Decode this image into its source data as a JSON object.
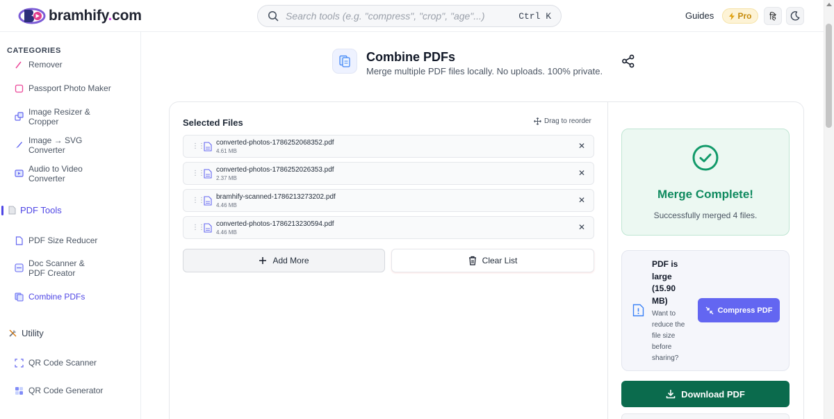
{
  "header": {
    "logo_text": "bramhify",
    "logo_dot": ".",
    "logo_tld": "com",
    "search_placeholder": "Search tools (e.g. \"compress\", \"crop\", \"age\"...)",
    "search_shortcut": "Ctrl K",
    "guides_label": "Guides",
    "pro_label": "Pro",
    "lang_label": "हि"
  },
  "sidebar": {
    "categories_title": "CATEGORIES",
    "image_items": [
      {
        "label": "Remover",
        "icon": "pencil-icon",
        "color": "#ec4899"
      },
      {
        "label": "Passport Photo Maker",
        "icon": "passport-icon",
        "color": "#ec4899"
      },
      {
        "label": "Image Resizer & Cropper",
        "icon": "resize-icon",
        "color": "#6366f1"
      },
      {
        "label": "Image → SVG Converter",
        "icon": "brush-icon",
        "color": "#6366f1"
      },
      {
        "label": "Audio to Video Converter",
        "icon": "video-icon",
        "color": "#6366f1"
      }
    ],
    "pdf_section": "PDF Tools",
    "pdf_items": [
      {
        "label": "PDF Size Reducer",
        "icon": "pdf-file-icon"
      },
      {
        "label": "Doc Scanner & PDF Creator",
        "icon": "scanner-icon"
      },
      {
        "label": "Combine PDFs",
        "icon": "combine-icon"
      }
    ],
    "utility_section": "Utility",
    "utility_items": [
      {
        "label": "QR Code Scanner",
        "icon": "qr-scan-icon"
      },
      {
        "label": "QR Code Generator",
        "icon": "qr-grid-icon"
      }
    ]
  },
  "page": {
    "title": "Combine PDFs",
    "subtitle": "Merge multiple PDF files locally. No uploads. 100% private."
  },
  "files": {
    "title": "Selected Files",
    "drag_hint": "Drag to reorder",
    "items": [
      {
        "name": "converted-photos-1786252068352.pdf",
        "size": "4.61 MB"
      },
      {
        "name": "converted-photos-1786252026353.pdf",
        "size": "2.37 MB"
      },
      {
        "name": "bramhify-scanned-1786213273202.pdf",
        "size": "4.46 MB"
      },
      {
        "name": "converted-photos-1786213230594.pdf",
        "size": "4.46 MB"
      }
    ],
    "remove_symbol": "✕",
    "add_more_label": "Add More",
    "clear_list_label": "Clear List"
  },
  "result": {
    "title": "Merge Complete!",
    "subtitle": "Successfully merged 4 files.",
    "large_title": "PDF is large (15.90 MB)",
    "large_subtitle": "Want to reduce the file size before sharing?",
    "compress_label": "Compress PDF",
    "download_label": "Download PDF"
  },
  "colors": {
    "accent": "#6366f1",
    "success": "#0f8a5f",
    "download": "#0b6b4d",
    "pro": "#c58a0a"
  }
}
